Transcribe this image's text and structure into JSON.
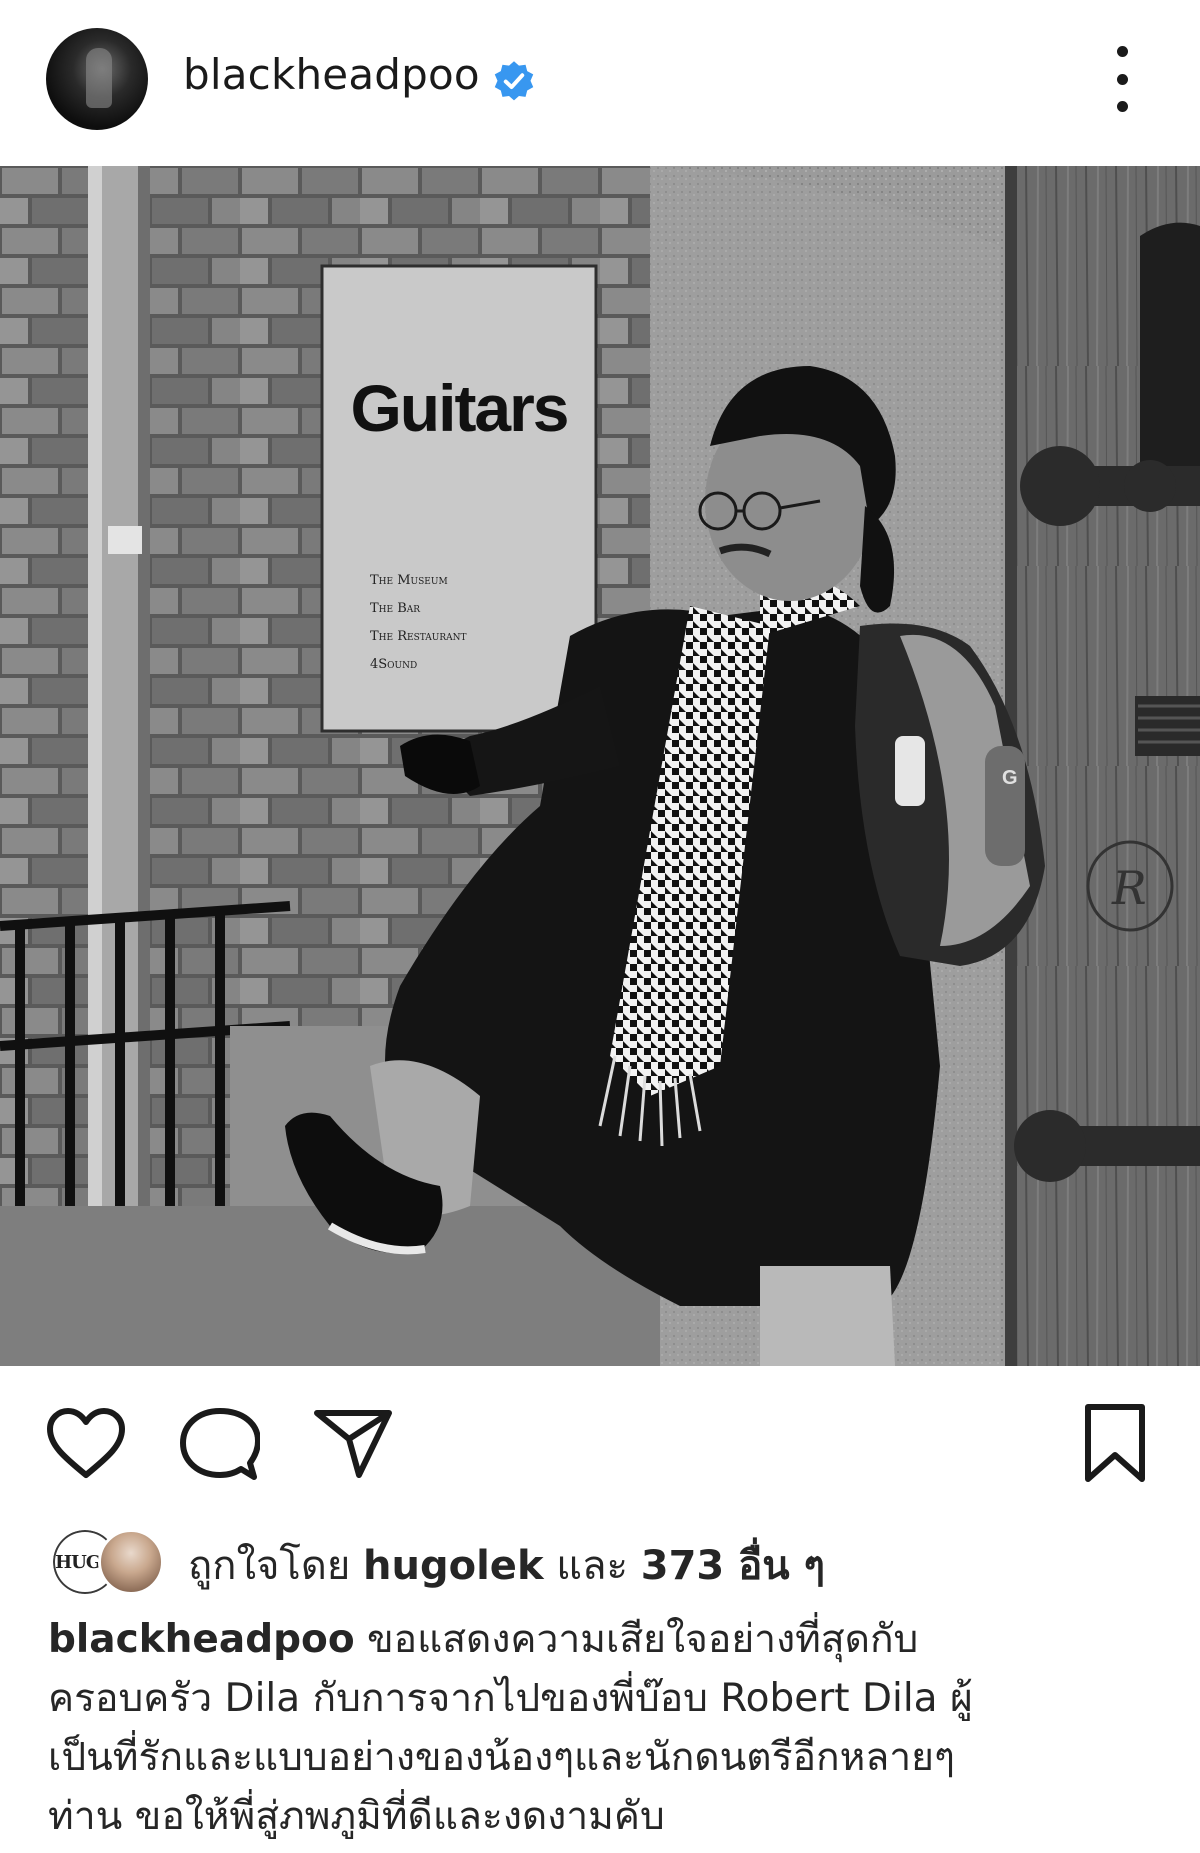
{
  "header": {
    "username": "blackheadpoo",
    "verified": true,
    "more_icon": "more-vertical-icon"
  },
  "photo": {
    "sign": {
      "title": "Guitars",
      "lines": [
        "The Museum",
        "The Bar",
        "The Restaurant",
        "4Sound"
      ]
    },
    "door_monogram": "R",
    "backpack_letter": "G"
  },
  "actions": {
    "like_icon": "heart-icon",
    "comment_icon": "comment-icon",
    "share_icon": "send-icon",
    "save_icon": "bookmark-icon"
  },
  "likes": {
    "avatar_text": "HUGO",
    "prefix": "ถูกใจโดย ",
    "user": "hugolek",
    "middle": " และ ",
    "count": "373 อื่น ๆ"
  },
  "caption": {
    "user": "blackheadpoo",
    "line1": " ขอแสดงความเสียใจอย่างที่สุดกับ",
    "line2": "ครอบครัว Dila กับการจากไปของพี่บ๊อบ Robert Dila ผู้",
    "line3": "เป็นที่รักและแบบอย่างของน้องๆและนักดนตรีอีกหลายๆ",
    "line4": "ท่าน  ขอให้พี่สู่ภพภูมิที่ดีและงดงามคับ"
  },
  "colors": {
    "verified_blue": "#3897f0",
    "text": "#262626",
    "icon": "#1a1a1a"
  }
}
